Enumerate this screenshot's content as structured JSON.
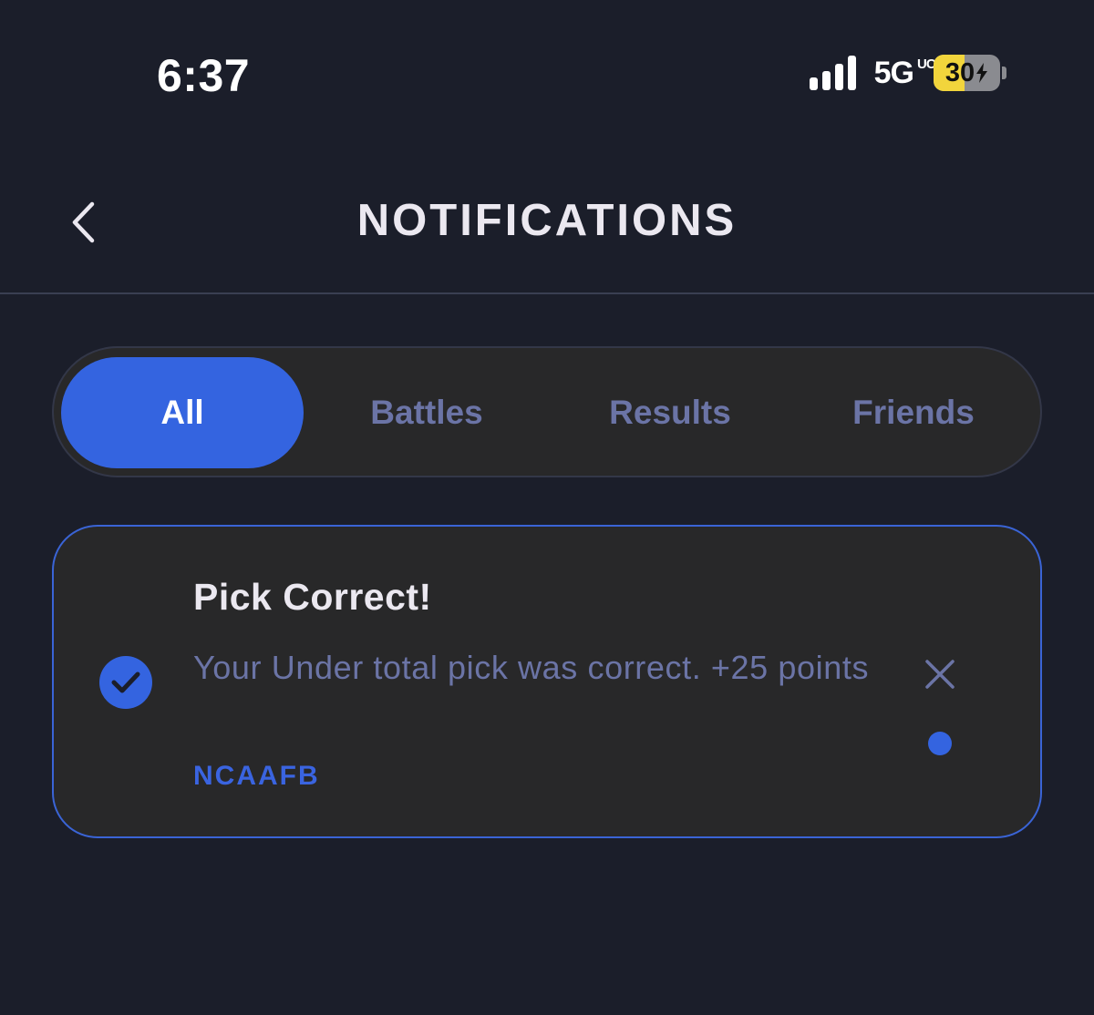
{
  "status_bar": {
    "time": "6:37",
    "signal_bars": 4,
    "network": "5G",
    "network_suffix": "UC",
    "battery_percent": "30",
    "battery_charging": true
  },
  "header": {
    "title": "NOTIFICATIONS",
    "back_icon": "chevron-left-icon"
  },
  "tabs": [
    {
      "label": "All",
      "active": true
    },
    {
      "label": "Battles",
      "active": false
    },
    {
      "label": "Results",
      "active": false
    },
    {
      "label": "Friends",
      "active": false
    }
  ],
  "notifications": [
    {
      "icon": "check-circle-icon",
      "title": "Pick Correct!",
      "body": "Your Under total pick was correct. +25 points",
      "tag": "NCAAFB",
      "unread": true,
      "dismiss_icon": "close-icon"
    }
  ],
  "colors": {
    "background": "#1b1e2a",
    "surface": "#282829",
    "accent": "#3464e0",
    "muted_text": "#6b74a6",
    "title_text": "#ebe8f0",
    "battery_fill": "#f2d53c"
  }
}
